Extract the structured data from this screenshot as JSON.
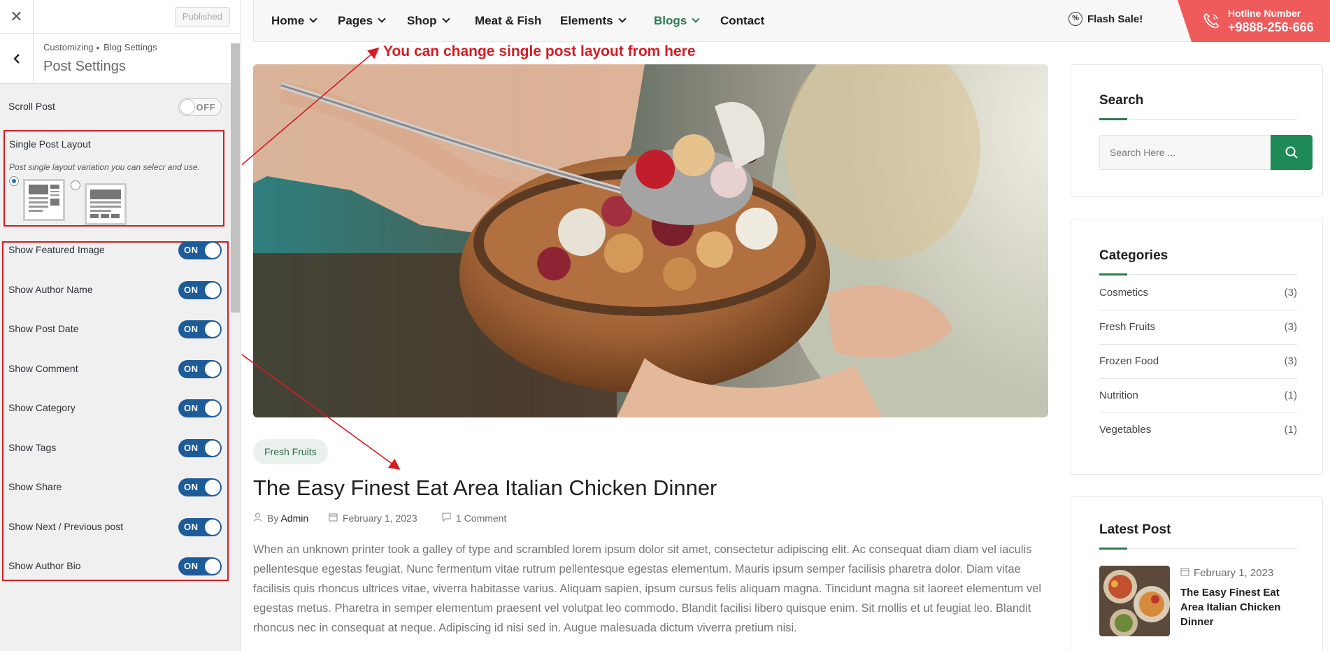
{
  "customizer": {
    "close_icon": "close-icon",
    "publish_label": "Published",
    "breadcrumb": [
      "Customizing",
      "Blog Settings"
    ],
    "section_title": "Post Settings",
    "scroll_post": {
      "label": "Scroll Post",
      "state": "OFF"
    },
    "single_post_layout": {
      "label": "Single Post Layout",
      "description": "Post single layout variation you can selecr and use.",
      "options": [
        {
          "id": "layout-1",
          "selected": true
        },
        {
          "id": "layout-2",
          "selected": false
        }
      ]
    },
    "toggles": [
      {
        "label": "Show Featured Image",
        "state": "ON"
      },
      {
        "label": "Show Author Name",
        "state": "ON"
      },
      {
        "label": "Show Post Date",
        "state": "ON"
      },
      {
        "label": "Show Comment",
        "state": "ON"
      },
      {
        "label": "Show Category",
        "state": "ON"
      },
      {
        "label": "Show Tags",
        "state": "ON"
      },
      {
        "label": "Show Share",
        "state": "ON"
      },
      {
        "label": "Show Next / Previous post",
        "state": "ON"
      },
      {
        "label": "Show Author Bio",
        "state": "ON"
      }
    ]
  },
  "annotation": {
    "text": "You can change single post layout from here",
    "color": "#d21d23"
  },
  "nav": {
    "items": [
      {
        "label": "Home",
        "dropdown": true
      },
      {
        "label": "Pages",
        "dropdown": true
      },
      {
        "label": "Shop",
        "dropdown": true
      },
      {
        "label": "Meat & Fish",
        "dropdown": false
      },
      {
        "label": "Elements",
        "dropdown": true
      },
      {
        "label": "Blogs",
        "dropdown": true,
        "active": true
      },
      {
        "label": "Contact",
        "dropdown": false
      }
    ],
    "flash_sale": "Flash Sale!",
    "hotline_label": "Hotline Number",
    "hotline_number": "+9888-256-666",
    "accent": "#2f7a4e",
    "hotline_color": "#ef5a5a"
  },
  "post": {
    "category": "Fresh Fruits",
    "title": "The Easy Finest Eat Area Italian Chicken Dinner",
    "author_prefix": "By",
    "author": "Admin",
    "date": "February 1, 2023",
    "comments": "1 Comment",
    "excerpt": "When an unknown printer took a galley of type and scrambled lorem ipsum dolor sit amet, consectetur adipiscing elit. Ac consequat diam diam vel iaculis pellentesque egestas feugiat. Nunc fermentum vitae rutrum pellentesque egestas elementum. Mauris ipsum semper facilisis pharetra dolor. Diam vitae facilisis quis rhoncus ultrices vitae, viverra habitasse varius. Aliquam sapien, ipsum cursus felis aliquam magna. Tincidunt magna sit laoreet elementum vel egestas metus. Pharetra in semper elementum praesent vel volutpat leo commodo. Blandit facilisi libero quisque enim. Sit mollis et ut feugiat leo. Blandit rhoncus nec in consequat at neque. Adipiscing id nisi sed in. Augue malesuada dictum viverra pretium nisi."
  },
  "sidebar": {
    "search": {
      "title": "Search",
      "placeholder": "Search Here ..."
    },
    "categories": {
      "title": "Categories",
      "items": [
        {
          "name": "Cosmetics",
          "count": "(3)"
        },
        {
          "name": "Fresh Fruits",
          "count": "(3)"
        },
        {
          "name": "Frozen Food",
          "count": "(3)"
        },
        {
          "name": "Nutrition",
          "count": "(1)"
        },
        {
          "name": "Vegetables",
          "count": "(1)"
        }
      ]
    },
    "latest": {
      "title": "Latest Post",
      "date": "February 1, 2023",
      "post_title": "The Easy Finest Eat Area Italian Chicken Dinner"
    }
  }
}
